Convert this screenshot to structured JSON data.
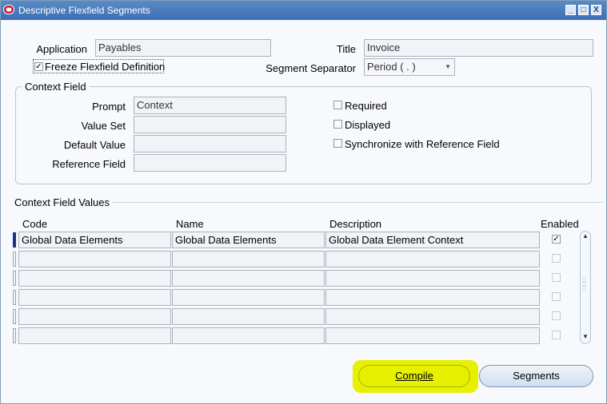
{
  "window": {
    "title": "Descriptive Flexfield Segments",
    "controls": [
      "_",
      "□",
      "X"
    ]
  },
  "header": {
    "application_label": "Application",
    "application_value": "Payables",
    "title_label": "Title",
    "title_value": "Invoice",
    "freeze_label": "Freeze Flexfield Definition",
    "freeze_checked": true,
    "separator_label": "Segment Separator",
    "separator_value": "Period ( . )"
  },
  "context_field": {
    "group_title": "Context Field",
    "prompt_label": "Prompt",
    "prompt_value": "Context",
    "value_set_label": "Value Set",
    "value_set_value": "",
    "default_value_label": "Default Value",
    "default_value_value": "",
    "reference_field_label": "Reference Field",
    "reference_field_value": "",
    "required_label": "Required",
    "displayed_label": "Displayed",
    "sync_label": "Synchronize with Reference Field"
  },
  "context_values": {
    "section_title": "Context Field Values",
    "columns": {
      "code": "Code",
      "name": "Name",
      "description": "Description",
      "enabled": "Enabled"
    },
    "rows": [
      {
        "code": "Global Data Elements",
        "name": "Global Data Elements",
        "description": "Global Data Element Context",
        "enabled": true
      },
      {
        "code": "",
        "name": "",
        "description": "",
        "enabled": false
      },
      {
        "code": "",
        "name": "",
        "description": "",
        "enabled": false
      },
      {
        "code": "",
        "name": "",
        "description": "",
        "enabled": false
      },
      {
        "code": "",
        "name": "",
        "description": "",
        "enabled": false
      },
      {
        "code": "",
        "name": "",
        "description": "",
        "enabled": false
      }
    ]
  },
  "buttons": {
    "compile": "Compile",
    "segments": "Segments"
  },
  "colors": {
    "highlight": "#e6f000",
    "titlebar": "#3c6eb4"
  }
}
